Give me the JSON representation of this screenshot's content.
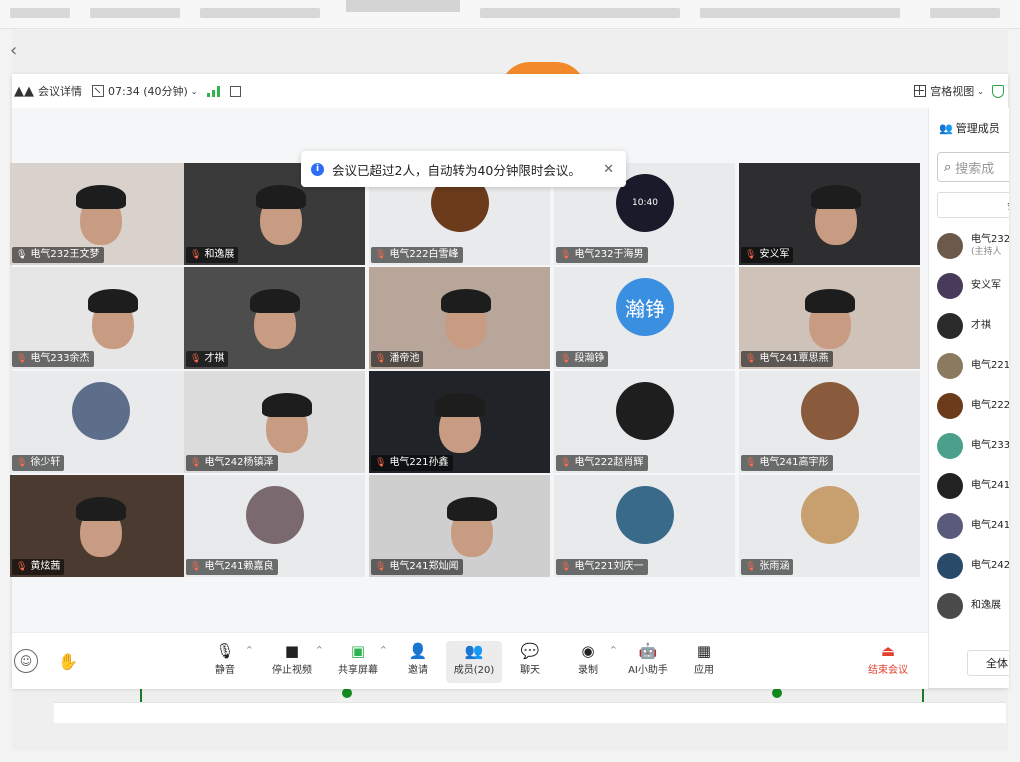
{
  "top_bar": {
    "meeting_details": "会议详情",
    "timer": "07:34 (40分钟)",
    "view_mode": "宫格视图"
  },
  "notice": {
    "text": "会议已超过2人，自动转为40分钟限时会议。",
    "close": "✕"
  },
  "participants": [
    {
      "name": "电气232王文梦",
      "type": "video",
      "bg": "#d9d2cc",
      "active": true,
      "mic": "on"
    },
    {
      "name": "和逸展",
      "type": "video",
      "bg": "#3a3a3a",
      "mic": "off"
    },
    {
      "name": "电气222白雪峰",
      "type": "avatar",
      "avatar_color": "#6b3b1c",
      "mic": "off"
    },
    {
      "name": "电气232于海男",
      "type": "avatar",
      "avatar_color": "#1a1a2a",
      "avatar_text": "10:40",
      "mic": "off"
    },
    {
      "name": "安义军",
      "type": "video",
      "bg": "#2e2e30",
      "mic": "off"
    },
    {
      "name": "电气233余杰",
      "type": "video",
      "bg": "#e6e6e6",
      "mic": "off"
    },
    {
      "name": "才祺",
      "type": "video",
      "bg": "#4d4d4d",
      "mic": "off"
    },
    {
      "name": "潘帝池",
      "type": "video",
      "bg": "#b9a69a",
      "mic": "off"
    },
    {
      "name": "段瀚铮",
      "type": "avatar",
      "avatar_color": "#3b8fe0",
      "avatar_text": "瀚铮",
      "mic": "off"
    },
    {
      "name": "电气241覃思燕",
      "type": "video",
      "bg": "#cfc2b8",
      "mic": "off"
    },
    {
      "name": "徐少轩",
      "type": "avatar",
      "avatar_color": "#5d6e8a",
      "mic": "off"
    },
    {
      "name": "电气242杨镇泽",
      "type": "video",
      "bg": "#dcdcdc",
      "mic": "off"
    },
    {
      "name": "电气221孙鑫",
      "type": "video",
      "bg": "#202428",
      "mic": "off"
    },
    {
      "name": "电气222赵肖辉",
      "type": "avatar",
      "avatar_color": "#1e1e1e",
      "mic": "off"
    },
    {
      "name": "电气241高宇彤",
      "type": "avatar",
      "avatar_color": "#8a5a3c",
      "mic": "off"
    },
    {
      "name": "黄炫茜",
      "type": "video",
      "bg": "#4a3a30",
      "mic": "off"
    },
    {
      "name": "电气241赖嘉良",
      "type": "avatar",
      "avatar_color": "#7a6a70",
      "mic": "off"
    },
    {
      "name": "电气241郑灿闻",
      "type": "video",
      "bg": "#cfcfcf",
      "mic": "off"
    },
    {
      "name": "电气221刘庆一",
      "type": "avatar",
      "avatar_color": "#3a6a8a",
      "mic": "off"
    },
    {
      "name": "张雨涵",
      "type": "avatar",
      "avatar_color": "#c8a070",
      "mic": "off"
    }
  ],
  "toolbar": {
    "mute": "静音",
    "stop_video": "停止视频",
    "share": "共享屏幕",
    "invite": "邀请",
    "members": "成员(20)",
    "chat": "聊天",
    "record": "录制",
    "ai": "AI小助手",
    "apps": "应用",
    "end": "结束会议"
  },
  "side_panel": {
    "title": "管理成员",
    "search_placeholder": "搜索成",
    "tab": "会",
    "members": [
      {
        "name": "电气232",
        "sub": "(主持人",
        "color": "#6b5a4a"
      },
      {
        "name": "安义军",
        "color": "#4a3a5a"
      },
      {
        "name": "才祺",
        "color": "#2a2a2a"
      },
      {
        "name": "电气221",
        "color": "#8a7a60"
      },
      {
        "name": "电气222",
        "color": "#6b3b1c"
      },
      {
        "name": "电气233",
        "color": "#4aa08a"
      },
      {
        "name": "电气241",
        "color": "#222222"
      },
      {
        "name": "电气241",
        "color": "#5a5a7a"
      },
      {
        "name": "电气242",
        "color": "#2a4a6a"
      },
      {
        "name": "和逸展",
        "color": "#4a4a4a"
      }
    ],
    "all_button": "全体"
  }
}
